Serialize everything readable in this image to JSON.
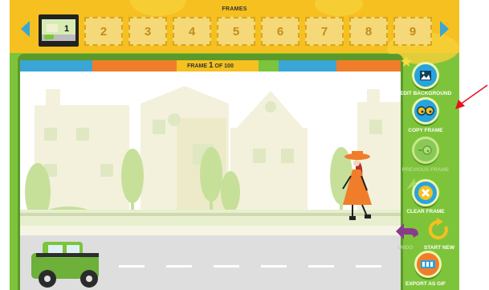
{
  "filmstrip": {
    "title": "FRAMES",
    "current_thumb_number": "1",
    "frame_numbers": [
      "2",
      "3",
      "4",
      "5",
      "6",
      "7",
      "8",
      "9"
    ]
  },
  "canvas": {
    "counter_prefix": "FRAME",
    "current_frame": "1",
    "counter_suffix": "OF 100"
  },
  "tools": {
    "edit_background": "EDIT BACKGROUND",
    "copy_frame": "COPY FRAME",
    "previous_frame": "PREVIOUS FRAME",
    "clear_frame": "CLEAR FRAME",
    "undo": "UNDO",
    "start_new": "START NEW",
    "export_as_gif": "EXPORT AS GIF"
  },
  "colors": {
    "app_green": "#7ec43a",
    "film_yellow": "#f5c020",
    "button_blue": "#29a3dc",
    "annotation_red": "#e8121e"
  }
}
